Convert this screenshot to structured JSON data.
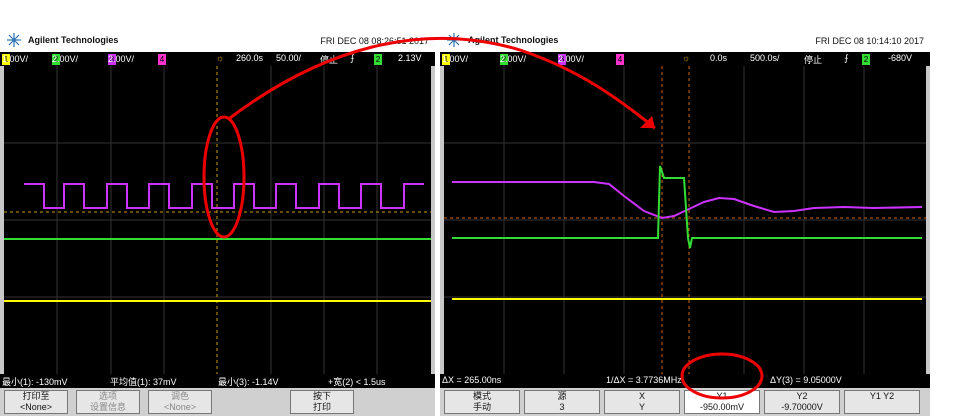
{
  "colors": {
    "ch1": "#ffff00",
    "ch2": "#33dd33",
    "ch3": "#cc33ff",
    "accent": "#e00000"
  },
  "left": {
    "brand": "Agilent Technologies",
    "datetime": "FRI DEC 08 08:26:51 2017",
    "status": {
      "ch1_scale": "1.00V/",
      "ch2_scale": "2.00V/",
      "ch3_scale": "2.00V/",
      "ch1_num": "1",
      "ch2_num": "2",
      "ch3_num": "3",
      "ch4_num": "4",
      "delay": "260.0s",
      "timebase": "50.00/",
      "mode": "停止",
      "trig_ch": "2",
      "trig_level": "2.13V"
    },
    "meas": {
      "m1": "最小(1): -130mV",
      "m2": "平均值(1): 37mV",
      "m3": "最小(3): -1.14V",
      "m4": "+宽(2) < 1.5us"
    },
    "softkeys": [
      {
        "line1": "打印至",
        "line2": "<None>"
      },
      {
        "line1": "选项",
        "line2": "设置信息"
      },
      {
        "line1": "调色",
        "line2": "<None>"
      },
      {
        "line1": "按下",
        "line2": "打印"
      }
    ]
  },
  "right": {
    "brand": "Agilent Technologies",
    "datetime": "FRI DEC 08 10:14:10 2017",
    "status": {
      "ch1_scale": "1.00V/",
      "ch2_scale": "2.00V/",
      "ch3_scale": "2.00V/",
      "ch1_num": "1",
      "ch2_num": "2",
      "ch3_num": "3",
      "ch4_num": "4",
      "delay": "0.0s",
      "timebase": "500.0s/",
      "mode": "停止",
      "trig_ch": "2",
      "trig_level": "-680V"
    },
    "meas": {
      "m1": "ΔX = 265.00ns",
      "m2": "1/ΔX = 3.7736MHz",
      "m3": "ΔY(3) = 9.05000V"
    },
    "softkeys": [
      {
        "line1": "模式",
        "line2": "手动"
      },
      {
        "line1": "源",
        "line2": "3"
      },
      {
        "line1": "X",
        "line2": "Y"
      },
      {
        "line1": "Y1",
        "line2": "-950.00mV"
      },
      {
        "line1": "Y2",
        "line2": "-9.70000V"
      },
      {
        "line1": "Y1 Y2",
        "line2": ""
      }
    ]
  }
}
